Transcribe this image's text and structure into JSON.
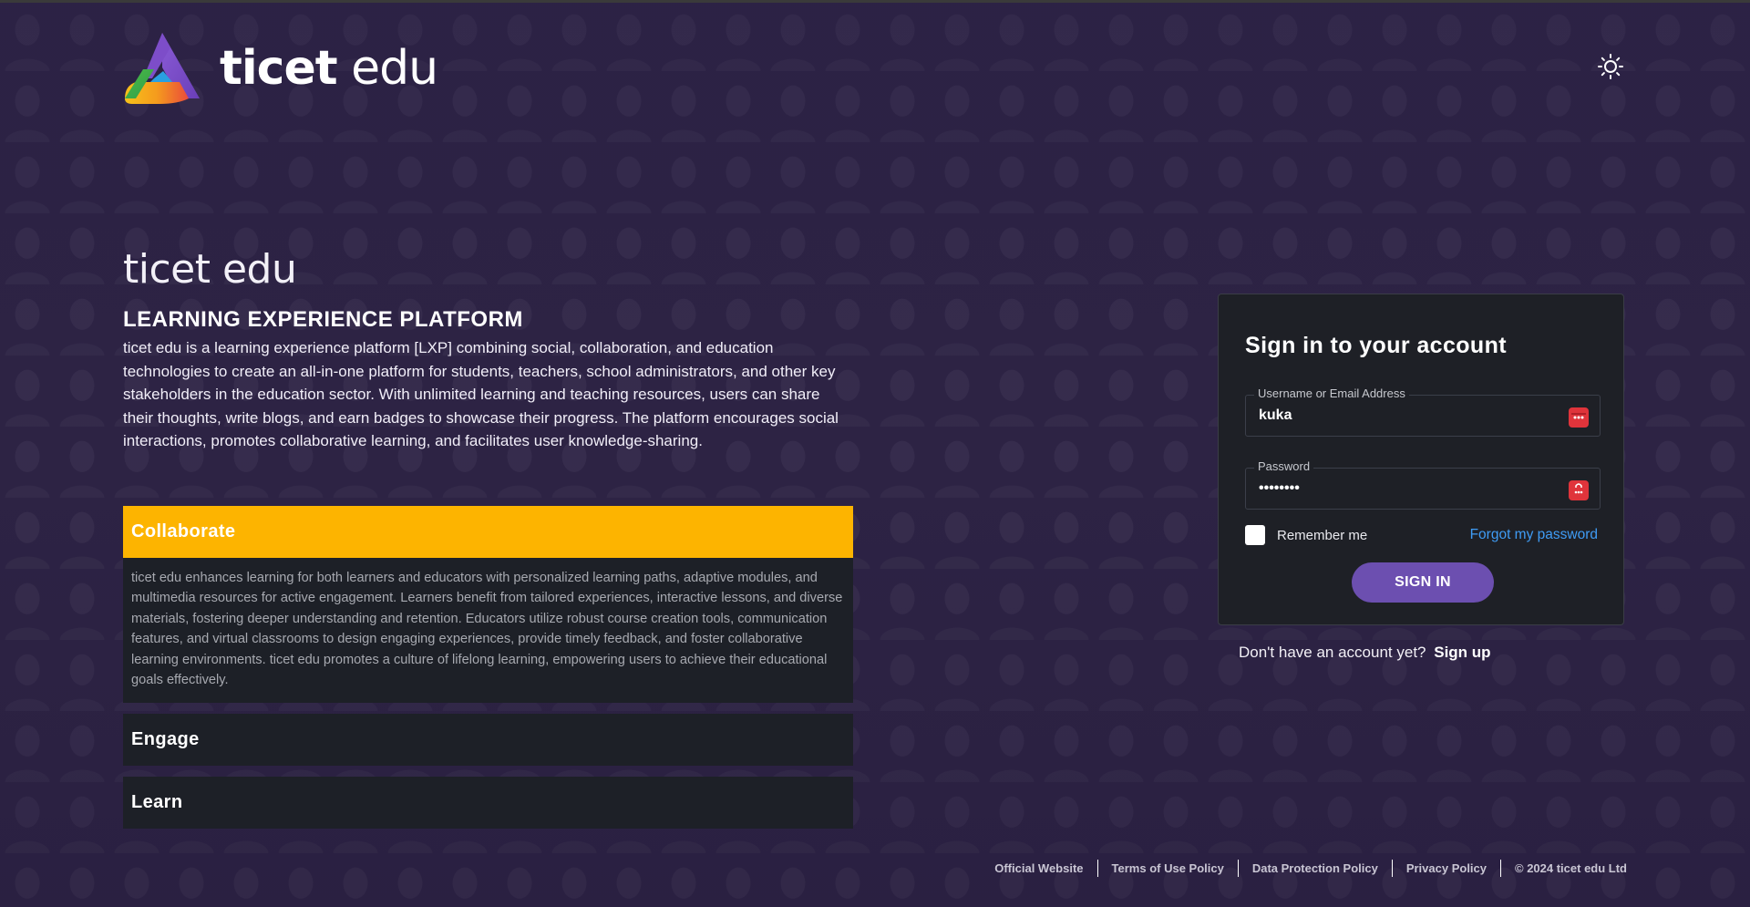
{
  "brand": {
    "name_bold": "ticet",
    "name_light": " edu",
    "colors": {
      "accent_yellow": "#fdb400",
      "primary_purple": "#6c4fb0",
      "link_blue": "#3f9cf5",
      "background": "#2e2444",
      "card": "#1e2026"
    }
  },
  "header": {
    "theme_toggle_icon": "sun-icon"
  },
  "hero": {
    "title": "ticet edu",
    "subtitle": "LEARNING EXPERIENCE PLATFORM",
    "description": "ticet edu is a learning experience platform [LXP] combining social, collaboration, and education technologies to create an all-in-one platform for students, teachers, school administrators, and other key stakeholders in the education sector. With unlimited learning and teaching resources, users can share their thoughts, write blogs, and earn badges to showcase their progress. The platform encourages social interactions, promotes collaborative learning, and facilitates user knowledge-sharing."
  },
  "accordion": {
    "items": [
      {
        "title": "Collaborate",
        "expanded": true,
        "body": "ticet edu enhances learning for both learners and educators with personalized learning paths, adaptive modules, and multimedia resources for active engagement. Learners benefit from tailored experiences, interactive lessons, and diverse materials, fostering deeper understanding and retention. Educators utilize robust course creation tools, communication features, and virtual classrooms to design engaging experiences, provide timely feedback, and foster collaborative learning environments. ticet edu promotes a culture of lifelong learning, empowering users to achieve their educational goals effectively."
      },
      {
        "title": "Engage",
        "expanded": false
      },
      {
        "title": "Learn",
        "expanded": false
      }
    ]
  },
  "login": {
    "title": "Sign in to your account",
    "username_label": "Username or Email Address",
    "username_value": "kuka",
    "password_label": "Password",
    "password_value": "••••••••",
    "remember_label": "Remember me",
    "forgot_label": "Forgot my password",
    "signin_label": "SIGN IN",
    "signup_prompt": "Don't have an account yet?",
    "signup_link": "Sign up"
  },
  "footer": {
    "links": [
      "Official Website",
      "Terms of Use Policy",
      "Data Protection Policy",
      "Privacy Policy"
    ],
    "copyright": "© 2024 ticet edu Ltd"
  }
}
